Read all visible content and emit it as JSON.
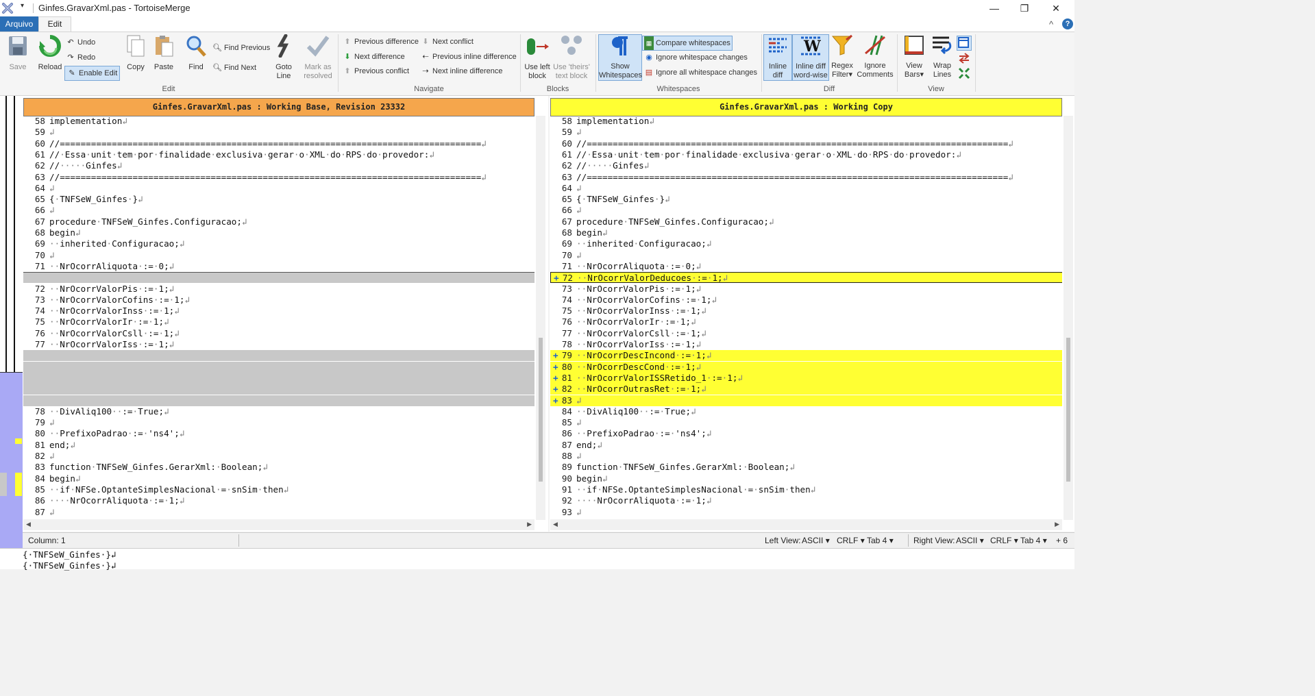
{
  "window": {
    "title": "Ginfes.GravarXml.pas - TortoiseMerge",
    "qat": "▾",
    "minimize": "—",
    "maximize": "❐",
    "close": "✕"
  },
  "ribbon_tabs": {
    "arquivo": "Arquivo",
    "edit": "Edit",
    "collapse": "^",
    "help": "?"
  },
  "edit_group": {
    "label": "Edit",
    "save": "Save",
    "reload": "Reload",
    "undo": "Undo",
    "redo": "Redo",
    "enable_edit": "Enable Edit",
    "copy": "Copy",
    "paste": "Paste",
    "find": "Find",
    "find_previous": "Find Previous",
    "find_next": "Find Next",
    "goto_line_1": "Goto",
    "goto_line_2": "Line",
    "mark_resolved_1": "Mark as",
    "mark_resolved_2": "resolved"
  },
  "navigate_group": {
    "label": "Navigate",
    "previous_difference": "Previous difference",
    "next_difference": "Next difference",
    "previous_conflict": "Previous conflict",
    "next_conflict": "Next conflict",
    "previous_inline": "Previous inline difference",
    "next_inline": "Next inline difference"
  },
  "blocks_group": {
    "label": "Blocks",
    "use_left_1": "Use left",
    "use_left_2": "block",
    "use_theirs_1": "Use 'theirs'",
    "use_theirs_2": "text block"
  },
  "whitespaces_group": {
    "label": "Whitespaces",
    "show_ws_1": "Show",
    "show_ws_2": "Whitespaces",
    "compare_ws": "Compare whitespaces",
    "ignore_ws_changes": "Ignore whitespace changes",
    "ignore_all_ws": "Ignore all whitespace changes"
  },
  "diff_group": {
    "label": "Diff",
    "inline_diff_1": "Inline",
    "inline_diff_2": "diff",
    "inline_word_1": "Inline diff",
    "inline_word_2": "word-wise",
    "regex_1": "Regex",
    "regex_2": "Filter",
    "ignore_comments_1": "Ignore",
    "ignore_comments_2": "Comments"
  },
  "view_group": {
    "label": "View",
    "view_bars_1": "View",
    "view_bars_2": "Bars",
    "wrap_lines_1": "Wrap",
    "wrap_lines_2": "Lines"
  },
  "left_pane": {
    "header": "Ginfes.GravarXml.pas : Working Base, Revision 23332",
    "header_color": "#f5a64c",
    "lines": [
      {
        "n": "58",
        "t": "implementation↲"
      },
      {
        "n": "59",
        "t": "↲"
      },
      {
        "n": "60",
        "t": "//=================================================================================↲"
      },
      {
        "n": "61",
        "t": "//·Essa·unit·tem·por·finalidade·exclusiva·gerar·o·XML·do·RPS·do·provedor:↲"
      },
      {
        "n": "62",
        "t": "//·····Ginfes↲"
      },
      {
        "n": "63",
        "t": "//=================================================================================↲"
      },
      {
        "n": "64",
        "t": "↲"
      },
      {
        "n": "65",
        "t": "{·TNFSeW_Ginfes·}↲"
      },
      {
        "n": "66",
        "t": "↲"
      },
      {
        "n": "67",
        "t": "procedure·TNFSeW_Ginfes.Configuracao;↲"
      },
      {
        "n": "68",
        "t": "begin↲"
      },
      {
        "n": "69",
        "t": "··inherited·Configuracao;↲"
      },
      {
        "n": "70",
        "t": "↲"
      },
      {
        "n": "71",
        "t": "··NrOcorrAliquota·:=·0;↲"
      },
      {
        "n": "",
        "t": ""
      },
      {
        "n": "72",
        "t": "··NrOcorrValorPis·:=·1;↲"
      },
      {
        "n": "73",
        "t": "··NrOcorrValorCofins·:=·1;↲"
      },
      {
        "n": "74",
        "t": "··NrOcorrValorInss·:=·1;↲"
      },
      {
        "n": "75",
        "t": "··NrOcorrValorIr·:=·1;↲"
      },
      {
        "n": "76",
        "t": "··NrOcorrValorCsll·:=·1;↲"
      },
      {
        "n": "77",
        "t": "··NrOcorrValorIss·:=·1;↲"
      },
      {
        "n": "",
        "t": ""
      },
      {
        "n": "",
        "t": ""
      },
      {
        "n": "",
        "t": ""
      },
      {
        "n": "",
        "t": ""
      },
      {
        "n": "",
        "t": ""
      },
      {
        "n": "78",
        "t": "··DivAliq100··:=·True;↲"
      },
      {
        "n": "79",
        "t": "↲"
      },
      {
        "n": "80",
        "t": "··PrefixoPadrao·:=·'ns4';↲"
      },
      {
        "n": "81",
        "t": "end;↲"
      },
      {
        "n": "82",
        "t": "↲"
      },
      {
        "n": "83",
        "t": "function·TNFSeW_Ginfes.GerarXml:·Boolean;↲"
      },
      {
        "n": "84",
        "t": "begin↲"
      },
      {
        "n": "85",
        "t": "··if·NFSe.OptanteSimplesNacional·=·snSim·then↲"
      },
      {
        "n": "86",
        "t": "····NrOcorrAliquota·:=·1;↲"
      },
      {
        "n": "87",
        "t": "↲"
      }
    ]
  },
  "right_pane": {
    "header": "Ginfes.GravarXml.pas : Working Copy",
    "header_color": "#ffff33",
    "lines": [
      {
        "n": "58",
        "t": "implementation↲",
        "m": ""
      },
      {
        "n": "59",
        "t": "↲",
        "m": ""
      },
      {
        "n": "60",
        "t": "//=================================================================================↲",
        "m": ""
      },
      {
        "n": "61",
        "t": "//·Essa·unit·tem·por·finalidade·exclusiva·gerar·o·XML·do·RPS·do·provedor:↲",
        "m": ""
      },
      {
        "n": "62",
        "t": "//·····Ginfes↲",
        "m": ""
      },
      {
        "n": "63",
        "t": "//=================================================================================↲",
        "m": ""
      },
      {
        "n": "64",
        "t": "↲",
        "m": ""
      },
      {
        "n": "65",
        "t": "{·TNFSeW_Ginfes·}↲",
        "m": ""
      },
      {
        "n": "66",
        "t": "↲",
        "m": ""
      },
      {
        "n": "67",
        "t": "procedure·TNFSeW_Ginfes.Configuracao;↲",
        "m": ""
      },
      {
        "n": "68",
        "t": "begin↲",
        "m": ""
      },
      {
        "n": "69",
        "t": "··inherited·Configuracao;↲",
        "m": ""
      },
      {
        "n": "70",
        "t": "↲",
        "m": ""
      },
      {
        "n": "71",
        "t": "··NrOcorrAliquota·:=·0;↲",
        "m": ""
      },
      {
        "n": "72",
        "t": "··NrOcorrValorDeducoes·:=·1;↲",
        "m": "+"
      },
      {
        "n": "73",
        "t": "··NrOcorrValorPis·:=·1;↲",
        "m": ""
      },
      {
        "n": "74",
        "t": "··NrOcorrValorCofins·:=·1;↲",
        "m": ""
      },
      {
        "n": "75",
        "t": "··NrOcorrValorInss·:=·1;↲",
        "m": ""
      },
      {
        "n": "76",
        "t": "··NrOcorrValorIr·:=·1;↲",
        "m": ""
      },
      {
        "n": "77",
        "t": "··NrOcorrValorCsll·:=·1;↲",
        "m": ""
      },
      {
        "n": "78",
        "t": "··NrOcorrValorIss·:=·1;↲",
        "m": ""
      },
      {
        "n": "79",
        "t": "··NrOcorrDescIncond·:=·1;↲",
        "m": "+"
      },
      {
        "n": "80",
        "t": "··NrOcorrDescCond·:=·1;↲",
        "m": "+"
      },
      {
        "n": "81",
        "t": "··NrOcorrValorISSRetido_1·:=·1;↲",
        "m": "+"
      },
      {
        "n": "82",
        "t": "··NrOcorrOutrasRet·:=·1;↲",
        "m": "+"
      },
      {
        "n": "83",
        "t": "↲",
        "m": "+"
      },
      {
        "n": "84",
        "t": "··DivAliq100··:=·True;↲",
        "m": ""
      },
      {
        "n": "85",
        "t": "↲",
        "m": ""
      },
      {
        "n": "86",
        "t": "··PrefixoPadrao·:=·'ns4';↲",
        "m": ""
      },
      {
        "n": "87",
        "t": "end;↲",
        "m": ""
      },
      {
        "n": "88",
        "t": "↲",
        "m": ""
      },
      {
        "n": "89",
        "t": "function·TNFSeW_Ginfes.GerarXml:·Boolean;↲",
        "m": ""
      },
      {
        "n": "90",
        "t": "begin↲",
        "m": ""
      },
      {
        "n": "91",
        "t": "··if·NFSe.OptanteSimplesNacional·=·snSim·then↲",
        "m": ""
      },
      {
        "n": "92",
        "t": "····NrOcorrAliquota·:=·1;↲",
        "m": ""
      },
      {
        "n": "93",
        "t": "↲",
        "m": ""
      }
    ]
  },
  "status": {
    "column": "Column: 1",
    "left_view_label": "Left View:",
    "left_encoding": "ASCII",
    "left_eol": "CRLF",
    "left_tab": "Tab 4",
    "right_view_label": "Right View:",
    "right_encoding": "ASCII",
    "right_eol": "CRLF",
    "right_tab": "Tab 4",
    "extra": "+ 6"
  },
  "bottom_pane": {
    "lines": [
      "{·TNFSeW_Ginfes·}↲",
      "{·TNFSeW_Ginfes·}↲"
    ]
  },
  "colors": {
    "added": "#ffff33",
    "removed_placeholder": "#c8c8c8",
    "gutter": "#c8c8c8",
    "location_bar": "#a9a9f5"
  }
}
